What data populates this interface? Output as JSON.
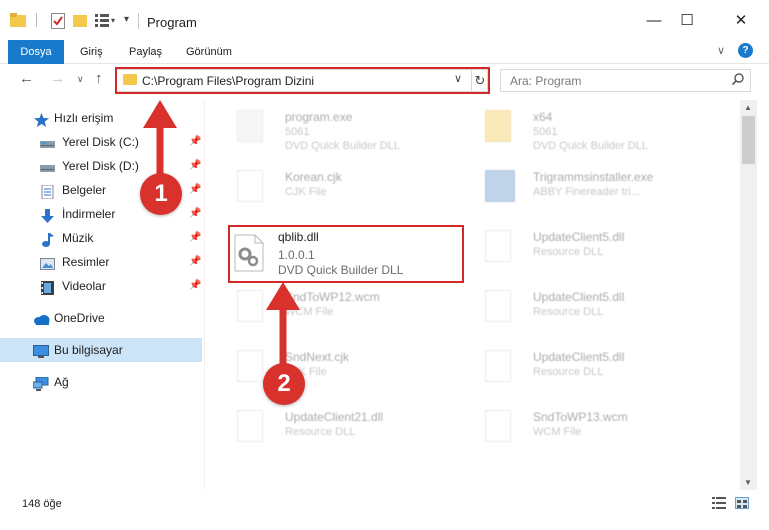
{
  "window": {
    "title": "Program",
    "minimize": "—",
    "maximize": "☐",
    "close": "✕"
  },
  "ribbon": {
    "tabs": [
      {
        "label": "Dosya",
        "active": true
      },
      {
        "label": "Giriş",
        "active": false
      },
      {
        "label": "Paylaş",
        "active": false
      },
      {
        "label": "Görünüm",
        "active": false
      }
    ],
    "expand": "∨",
    "help": "?"
  },
  "nav": {
    "back": "←",
    "forward": "→",
    "recent": "∨",
    "up": "↑"
  },
  "address": {
    "path": "C:\\Program Files\\Program Dizini",
    "dropdown": "∨",
    "refresh": "↻"
  },
  "search": {
    "placeholder": "Ara: Program",
    "icon": "search-icon"
  },
  "sidebar": {
    "items": [
      {
        "label": "Hızlı erişim",
        "icon": "star-icon",
        "pinned": false
      },
      {
        "label": "Yerel Disk (C:)",
        "icon": "drive-icon",
        "pinned": true
      },
      {
        "label": "Yerel Disk (D:)",
        "icon": "drive-icon",
        "pinned": true
      },
      {
        "label": "Belgeler",
        "icon": "document-icon",
        "pinned": true
      },
      {
        "label": "İndirmeler",
        "icon": "download-icon",
        "pinned": true
      },
      {
        "label": "Müzik",
        "icon": "music-icon",
        "pinned": true
      },
      {
        "label": "Resimler",
        "icon": "picture-icon",
        "pinned": true
      },
      {
        "label": "Videolar",
        "icon": "video-icon",
        "pinned": true
      },
      {
        "label": "OneDrive",
        "icon": "cloud-icon",
        "pinned": false
      },
      {
        "label": "Bu bilgisayar",
        "icon": "computer-icon",
        "pinned": false,
        "selected": true
      },
      {
        "label": "Ağ",
        "icon": "network-icon",
        "pinned": false
      }
    ]
  },
  "files": [
    {
      "name": "program.exe",
      "line1": "5061",
      "line2": "DVD Quick Builder DLL"
    },
    {
      "name": "x64",
      "line1": "5061",
      "line2": "DVD Quick Builder DLL"
    },
    {
      "name": "Korean.cjk",
      "line1": "CJK File",
      "line2": ""
    },
    {
      "name": "Trigrammsinstaller.exe",
      "line1": "ABBY Finereader tri...",
      "line2": ""
    },
    {
      "name": "UpdateClient5.dll",
      "line1": "Resource DLL",
      "line2": ""
    },
    {
      "name": "SndToWP12.wcm",
      "line1": "WCM File",
      "line2": ""
    },
    {
      "name": "UpdateClient5.dll",
      "line1": "Resource DLL",
      "line2": ""
    },
    {
      "name": "SndNext.cjk",
      "line1": "CJK File",
      "line2": ""
    },
    {
      "name": "UpdateClient5.dll",
      "line1": "Resource DLL",
      "line2": ""
    },
    {
      "name": "UpdateClient21.dll",
      "line1": "Resource DLL",
      "line2": ""
    },
    {
      "name": "SndToWP13.wcm",
      "line1": "WCM File",
      "line2": ""
    }
  ],
  "focus_file": {
    "name": "qblib.dll",
    "version": "1.0.0.1",
    "description": "DVD Quick Builder DLL"
  },
  "callouts": [
    "1",
    "2"
  ],
  "status": {
    "item_count": "148 öğe"
  },
  "colors": {
    "accent": "#1979ca",
    "highlight": "#d22a2a",
    "callout": "#d9322d",
    "selected": "#cce4f7"
  }
}
